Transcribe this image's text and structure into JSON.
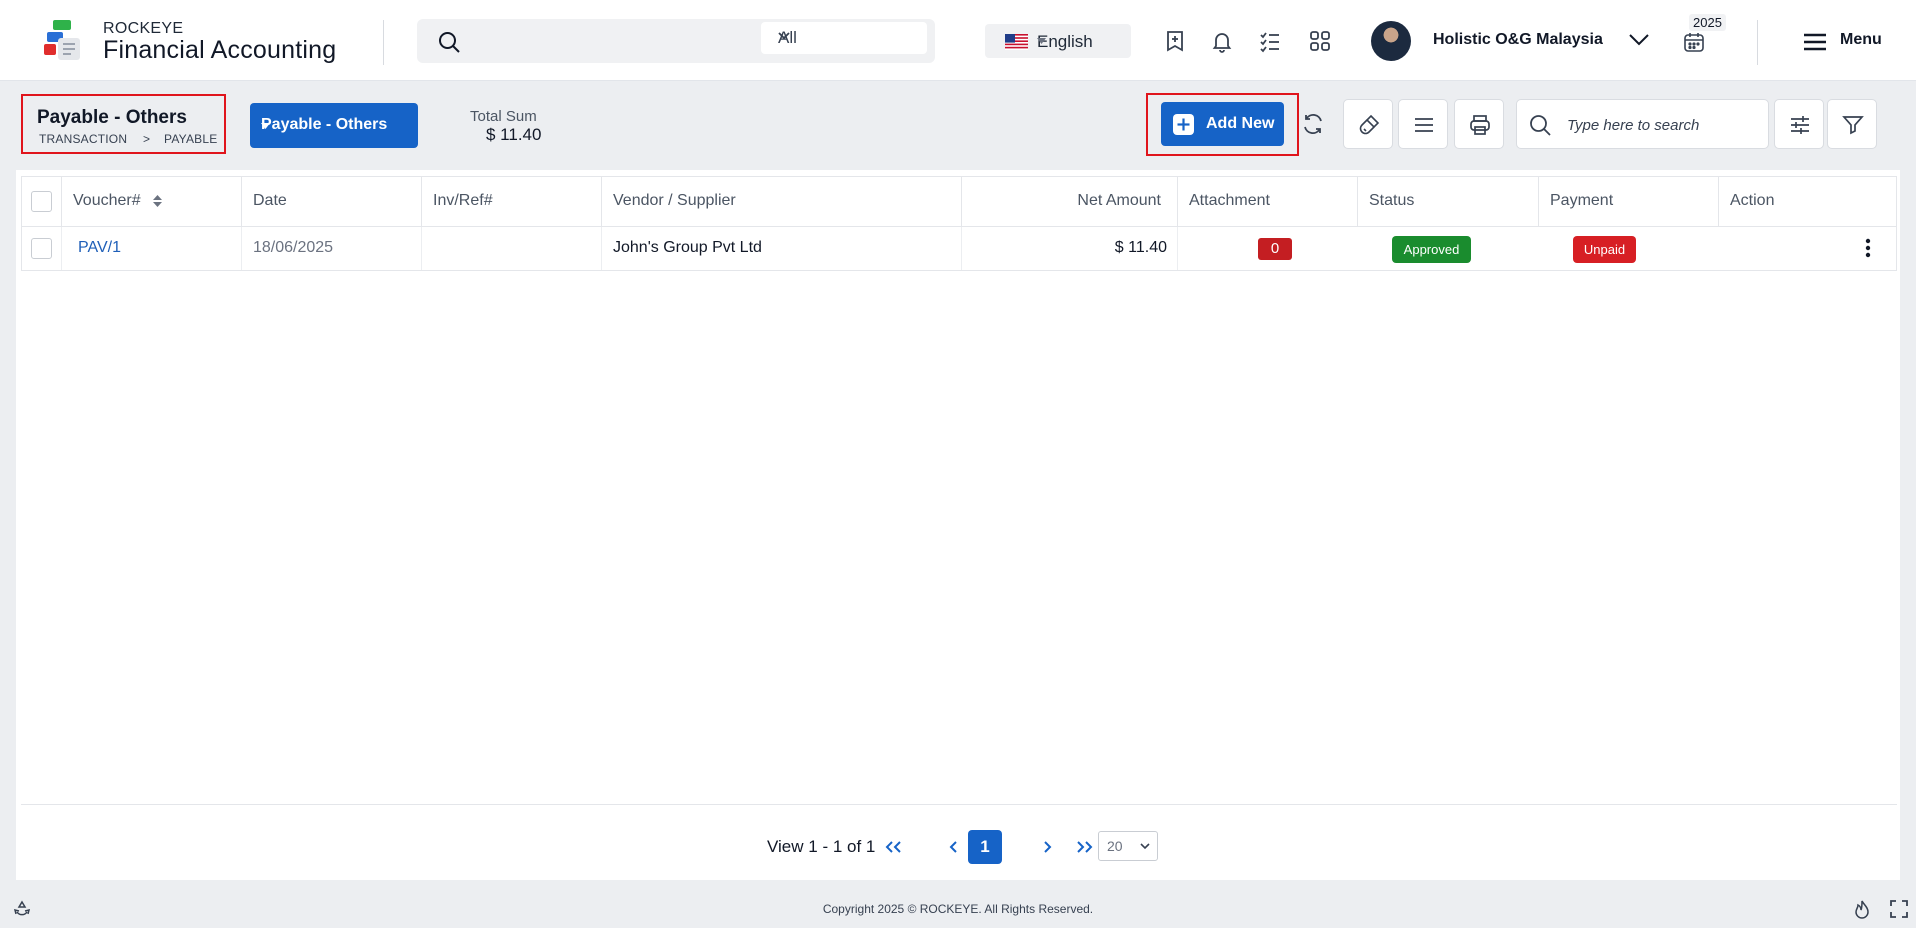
{
  "brand": {
    "small": "ROCKEYE",
    "big": "Financial Accounting"
  },
  "search": {
    "placeholder": "",
    "scope": "All"
  },
  "language": {
    "label": "English"
  },
  "header": {
    "company": "Holistic O&G Malaysia",
    "year": "2025",
    "menu_label": "Menu"
  },
  "page": {
    "title": "Payable - Others",
    "breadcrumb": [
      "TRANSACTION",
      ">",
      "PAYABLE"
    ],
    "type_select": "Payable - Others",
    "total_label": "Total Sum",
    "total_value": "$ 11.40",
    "add_new_label": "Add New",
    "search_placeholder": "Type here to search"
  },
  "table": {
    "columns": [
      "Voucher#",
      "Date",
      "Inv/Ref#",
      "Vendor / Supplier",
      "Net Amount",
      "Attachment",
      "Status",
      "Payment",
      "Action"
    ],
    "rows": [
      {
        "voucher": "PAV/1",
        "date": "18/06/2025",
        "inv_ref": "",
        "vendor": "John's Group Pvt Ltd",
        "net_amount": "$ 11.40",
        "attachment": "0",
        "status": "Approved",
        "payment": "Unpaid"
      }
    ]
  },
  "pagination": {
    "info": "View 1 - 1 of 1",
    "current_page": "1",
    "page_size": "20"
  },
  "footer": {
    "copyright": "Copyright 2025 © ROCKEYE. All Rights Reserved."
  },
  "colors": {
    "primary": "#1663c7",
    "highlight": "#e0141c",
    "approved": "#1a8c2e",
    "unpaid": "#d71f24",
    "attachment": "#c41e22"
  },
  "icons": [
    "search-icon",
    "chevron-down-icon",
    "bookmark-add-icon",
    "bell-icon",
    "checklist-icon",
    "apps-grid-icon",
    "calendar-icon",
    "hamburger-menu-icon",
    "refresh-icon",
    "brush-icon",
    "list-icon",
    "print-icon",
    "sliders-icon",
    "filter-icon",
    "kebab-icon",
    "recycle-icon",
    "flame-icon",
    "fullscreen-icon"
  ]
}
